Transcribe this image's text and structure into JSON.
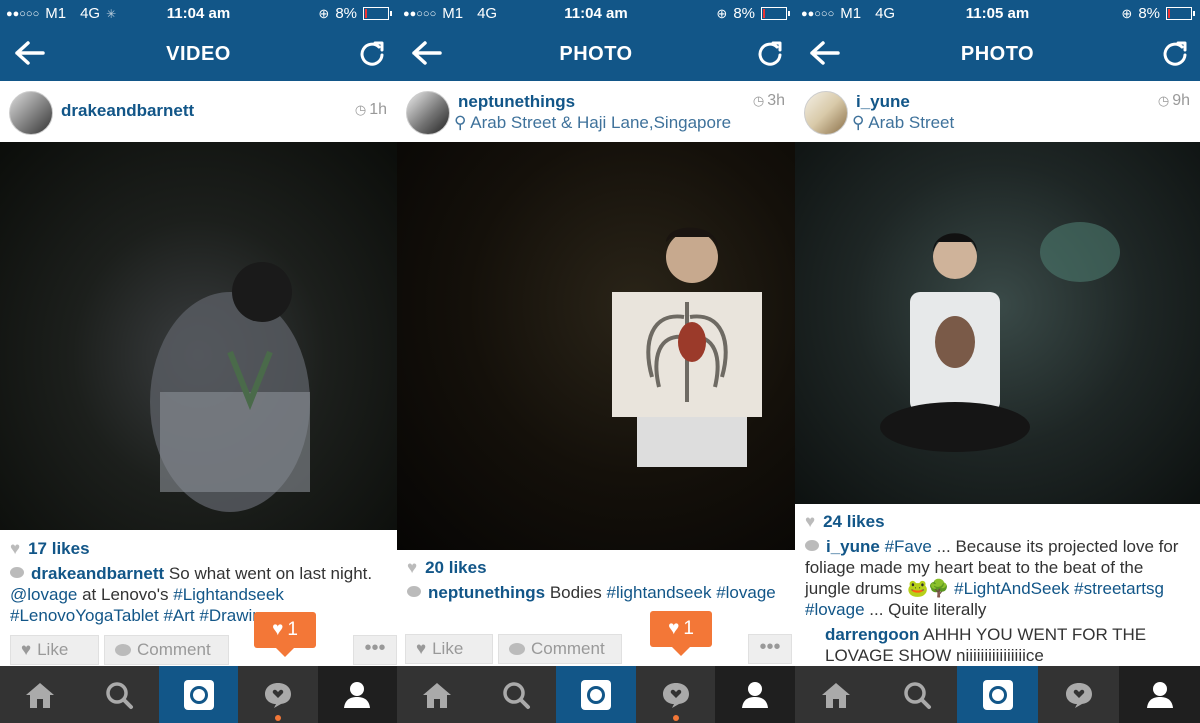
{
  "colors": {
    "brand": "#125688",
    "accent": "#f37737",
    "tabbar": "#333333"
  },
  "screens": [
    {
      "status": {
        "signal": "●●○○○",
        "carrier": "M1",
        "network": "4G",
        "time": "11:04 am",
        "battery": "8%"
      },
      "nav_title": "VIDEO",
      "post": {
        "username": "drakeandbarnett",
        "location": "",
        "time_ago": "1h",
        "likes": "17 likes",
        "caption_user": "drakeandbarnett",
        "caption_parts": [
          {
            "t": "text",
            "v": " So what went on last night. "
          },
          {
            "t": "tag",
            "v": "@lovage"
          },
          {
            "t": "text",
            "v": " at Lenovo's "
          },
          {
            "t": "tag",
            "v": "#Lightandseek"
          },
          {
            "t": "text",
            "v": " "
          },
          {
            "t": "tag",
            "v": "#LenovoYogaTablet"
          },
          {
            "t": "text",
            "v": " "
          },
          {
            "t": "tag",
            "v": "#Art"
          },
          {
            "t": "text",
            "v": " "
          },
          {
            "t": "tag",
            "v": "#Drawing"
          }
        ],
        "comments": []
      },
      "actions": {
        "like": "Like",
        "comment": "Comment",
        "more": "•••"
      },
      "notification_count": "1"
    },
    {
      "status": {
        "signal": "●●○○○",
        "carrier": "M1",
        "network": "4G",
        "time": "11:04 am",
        "battery": "8%"
      },
      "nav_title": "PHOTO",
      "post": {
        "username": "neptunethings",
        "location": "Arab Street & Haji Lane,Singapore",
        "time_ago": "3h",
        "likes": "20 likes",
        "caption_user": "neptunethings",
        "caption_parts": [
          {
            "t": "text",
            "v": " Bodies "
          },
          {
            "t": "tag",
            "v": "#lightandseek"
          },
          {
            "t": "text",
            "v": " "
          },
          {
            "t": "tag",
            "v": "#lovage"
          }
        ],
        "comments": []
      },
      "actions": {
        "like": "Like",
        "comment": "Comment",
        "more": "•••"
      },
      "notification_count": "1"
    },
    {
      "status": {
        "signal": "●●○○○",
        "carrier": "M1",
        "network": "4G",
        "time": "11:05 am",
        "battery": "8%"
      },
      "nav_title": "PHOTO",
      "post": {
        "username": "i_yune",
        "location": "Arab Street",
        "time_ago": "9h",
        "likes": "24 likes",
        "caption_user": "i_yune",
        "caption_parts": [
          {
            "t": "text",
            "v": " "
          },
          {
            "t": "tag",
            "v": "#Fave"
          },
          {
            "t": "text",
            "v": " ... Because its projected love for foliage made my heart beat to the beat of the jungle drums 🐸🌳 "
          },
          {
            "t": "tag",
            "v": "#LightAndSeek"
          },
          {
            "t": "text",
            "v": " "
          },
          {
            "t": "tag",
            "v": "#streetartsg"
          },
          {
            "t": "text",
            "v": " "
          },
          {
            "t": "tag",
            "v": "#lovage"
          },
          {
            "t": "text",
            "v": " ... Quite literally"
          }
        ],
        "comments": [
          {
            "user": "darrengoon",
            "text": " AHHH YOU WENT FOR THE LOVAGE SHOW niiiiiiiiiiiiiiiice"
          }
        ]
      },
      "actions": {
        "like": "Like",
        "comment": "Comment",
        "more": "•••"
      },
      "notification_count": ""
    }
  ],
  "tabs": [
    {
      "name": "home",
      "icon": "home-icon"
    },
    {
      "name": "explore",
      "icon": "search-icon"
    },
    {
      "name": "camera",
      "icon": "camera-icon"
    },
    {
      "name": "activity",
      "icon": "activity-bubble-icon"
    },
    {
      "name": "profile",
      "icon": "profile-icon"
    }
  ]
}
